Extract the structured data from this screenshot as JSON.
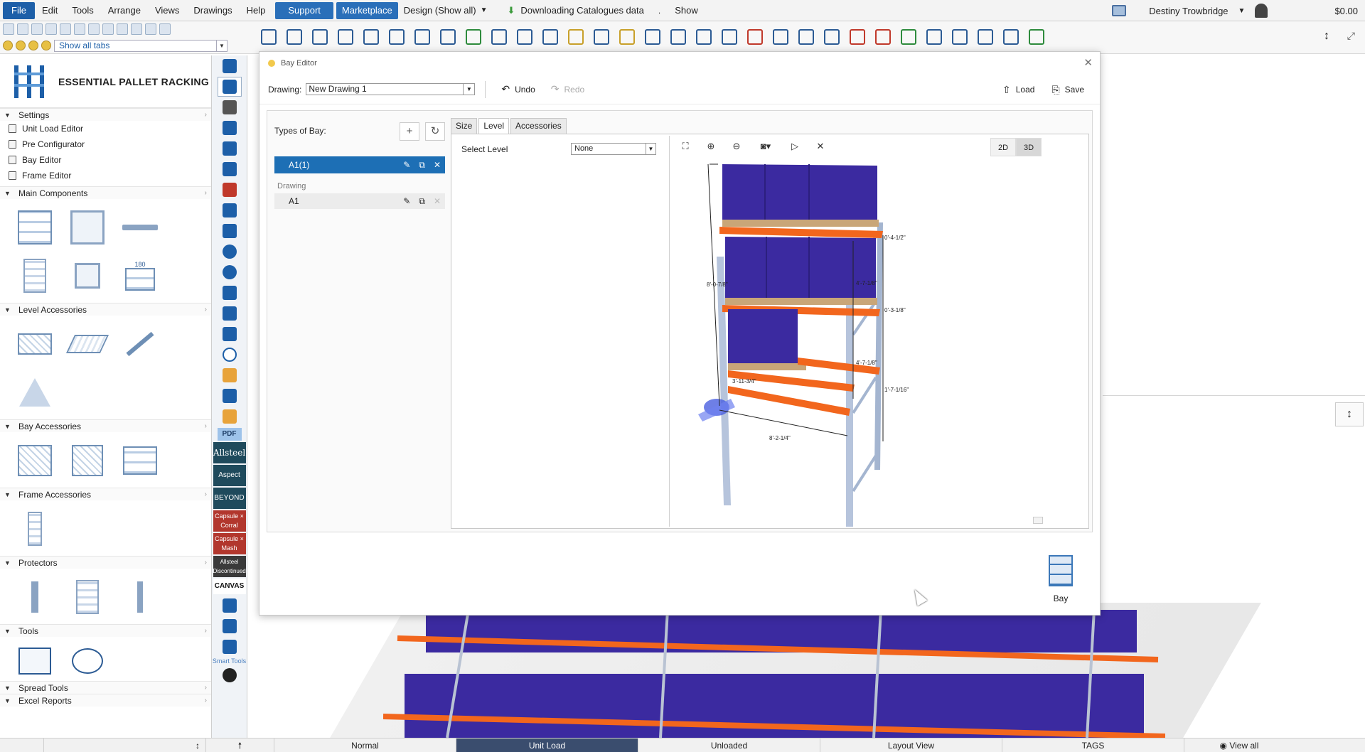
{
  "menu": {
    "items": [
      "File",
      "Edit",
      "Tools",
      "Arrange",
      "Views",
      "Drawings",
      "Help"
    ],
    "support": "Support",
    "marketplace": "Marketplace",
    "mode": "Design (Show all)",
    "downloading": "Downloading Catalogues data",
    "dot": ".",
    "show": "Show",
    "user": "Destiny Trowbridge",
    "balance": "$0.00"
  },
  "toolbar": {
    "tab_filter": "Show all tabs"
  },
  "sidebar": {
    "brand": "ESSENTIAL PALLET RACKING",
    "settings": {
      "title": "Settings",
      "items": [
        "Unit Load Editor",
        "Pre Configurator",
        "Bay Editor",
        "Frame Editor"
      ]
    },
    "sections": {
      "main": "Main Components",
      "level": "Level Accessories",
      "bay": "Bay Accessories",
      "frame": "Frame Accessories",
      "protectors": "Protectors",
      "tools": "Tools",
      "spread": "Spread Tools",
      "excel": "Excel Reports"
    },
    "rotate_label": "180"
  },
  "strip": {
    "pdf": "PDF",
    "allsteel": "Allsteel",
    "aspect": "Aspect",
    "beyond": "BEYOND",
    "capsule_corral": "Capsule × Corral",
    "capsule_mash": "Capsule × Mash",
    "allsteel_disc": "Allsteel Discontinued",
    "canvas": "CANVAS",
    "smart_tools": "Smart Tools"
  },
  "dialog": {
    "title": "Bay Editor",
    "drawing_label": "Drawing:",
    "drawing_value": "New Drawing 1",
    "undo": "Undo",
    "redo": "Redo",
    "load": "Load",
    "save": "Save",
    "types_label": "Types of Bay:",
    "selected_type": "A1(1)",
    "drawing_group": "Drawing",
    "drawing_item": "A1",
    "tabs": [
      "Size",
      "Level",
      "Accessories"
    ],
    "select_level_label": "Select Level",
    "select_level_value": "None",
    "view_2d": "2D",
    "view_3d": "3D",
    "bay_label": "Bay"
  },
  "dimensions": [
    "8'-0-7/8\"",
    "4'-7-1/8\"",
    "4'-7-1/8\"",
    "3'-11-3/4\"",
    "8'-2-1/4\"",
    "0'-4-1/2\"",
    "0'-3-1/8\"",
    "1'-7-1/16\""
  ],
  "status": {
    "normal": "Normal",
    "unit_load": "Unit Load",
    "unloaded": "Unloaded",
    "layout_view": "Layout View",
    "tags": "TAGS",
    "view_all": "View all"
  },
  "colors": {
    "accent": "#1d6fb5",
    "beam": "#f2661d",
    "box": "#3b2aa0",
    "pallet": "#c9a678",
    "upright": "#a9b9d4"
  }
}
